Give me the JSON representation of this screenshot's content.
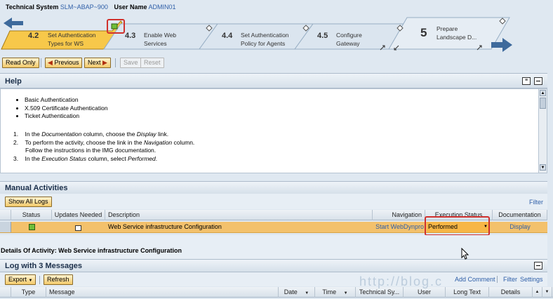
{
  "header": {
    "technical_system_label": "Technical System",
    "technical_system_value": "SLM~ABAP~900",
    "user_name_label": "User Name",
    "user_name_value": "ADMIN01"
  },
  "wizard": {
    "steps": [
      {
        "num": "4.2",
        "label1": "Set Authentication",
        "label2": "Types for WS",
        "active": true
      },
      {
        "num": "4.3",
        "label1": "Enable Web",
        "label2": "Services"
      },
      {
        "num": "4.4",
        "label1": "Set Authentication",
        "label2": "Policy for Agents"
      },
      {
        "num": "4.5",
        "label1": "Configure",
        "label2": "Gateway"
      },
      {
        "num": "5",
        "label1": "Prepare",
        "label2": "Landscape D..."
      }
    ]
  },
  "toolbar": {
    "read_only": "Read Only",
    "previous": "Previous",
    "next": "Next",
    "save": "Save",
    "reset": "Reset"
  },
  "help": {
    "title": "Help",
    "bullets": [
      "Basic Authentication",
      "X.509 Certificate Authentication",
      "Ticket Authentication"
    ],
    "step1_pre": "In the ",
    "step1_em1": "Documentation",
    "step1_mid": " column, choose the ",
    "step1_em2": "Display",
    "step1_post": " link.",
    "step2_pre": "To perform the activity, choose the link in the ",
    "step2_em": "Navigation",
    "step2_post": " column.",
    "step2_line2": "Follow the instructions in the IMG documentation.",
    "step3_pre": "In the ",
    "step3_em": "Execution Status",
    "step3_mid": " column, select ",
    "step3_em2": "Performed",
    "step3_post": "."
  },
  "manual": {
    "title": "Manual Activities",
    "show_all_logs": "Show All Logs",
    "filter": "Filter",
    "columns": [
      "Status",
      "Updates Needed",
      "Description",
      "Navigation",
      "Execution Status",
      "Documentation"
    ],
    "row": {
      "description": "Web Service infrastructure Configuration",
      "navigation": "Start WebDynpro",
      "execution_status": "Performed",
      "documentation": "Display"
    }
  },
  "details": {
    "title": "Details Of Activity: Web Service infrastructure Configuration"
  },
  "log": {
    "title": "Log with 3 Messages",
    "export": "Export",
    "refresh": "Refresh",
    "add_comment": "Add Comment",
    "filter": "Filter",
    "settings": "Settings",
    "columns": [
      "Type",
      "Message",
      "Date",
      "Time",
      "Technical Sy...",
      "User",
      "Long Text",
      "Details"
    ]
  },
  "watermark": "http://blog.c",
  "colors": {
    "active_step": "#f7c84a",
    "row_highlight": "#f3c16c",
    "highlight_box": "#d0312d",
    "link": "#2f5fa8"
  }
}
